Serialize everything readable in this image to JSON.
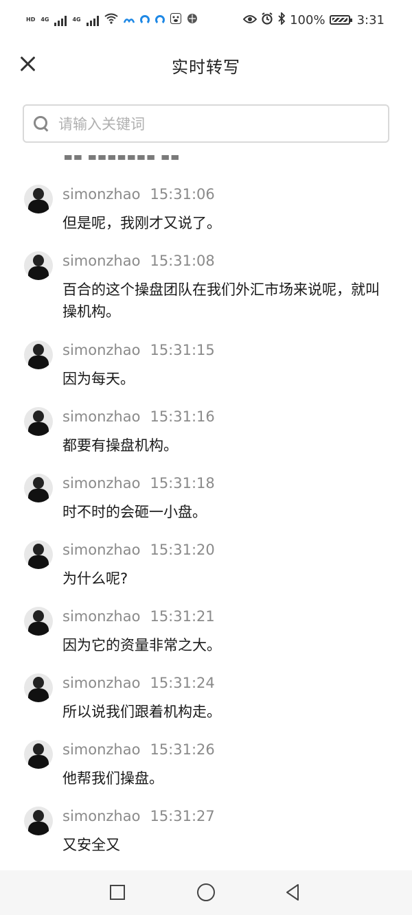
{
  "status_bar": {
    "sim1": "HD",
    "sim2": "4G",
    "sim3": "4G",
    "battery_text": "100%",
    "time": "3:31"
  },
  "header": {
    "title": "实时转写"
  },
  "search": {
    "placeholder": "请输入关键词",
    "value": ""
  },
  "messages": [
    {
      "user": "simonzhao",
      "time": "15:31:06",
      "text": "但是呢，我刚才又说了。"
    },
    {
      "user": "simonzhao",
      "time": "15:31:08",
      "text": "百合的这个操盘团队在我们外汇市场来说呢，就叫操机构。"
    },
    {
      "user": "simonzhao",
      "time": "15:31:15",
      "text": "因为每天。"
    },
    {
      "user": "simonzhao",
      "time": "15:31:16",
      "text": "都要有操盘机构。"
    },
    {
      "user": "simonzhao",
      "time": "15:31:18",
      "text": "时不时的会砸一小盘。"
    },
    {
      "user": "simonzhao",
      "time": "15:31:20",
      "text": "为什么呢?"
    },
    {
      "user": "simonzhao",
      "time": "15:31:21",
      "text": "因为它的资量非常之大。"
    },
    {
      "user": "simonzhao",
      "time": "15:31:24",
      "text": "所以说我们跟着机构走。"
    },
    {
      "user": "simonzhao",
      "time": "15:31:26",
      "text": "他帮我们操盘。"
    },
    {
      "user": "simonzhao",
      "time": "15:31:27",
      "text": "又安全又"
    }
  ]
}
